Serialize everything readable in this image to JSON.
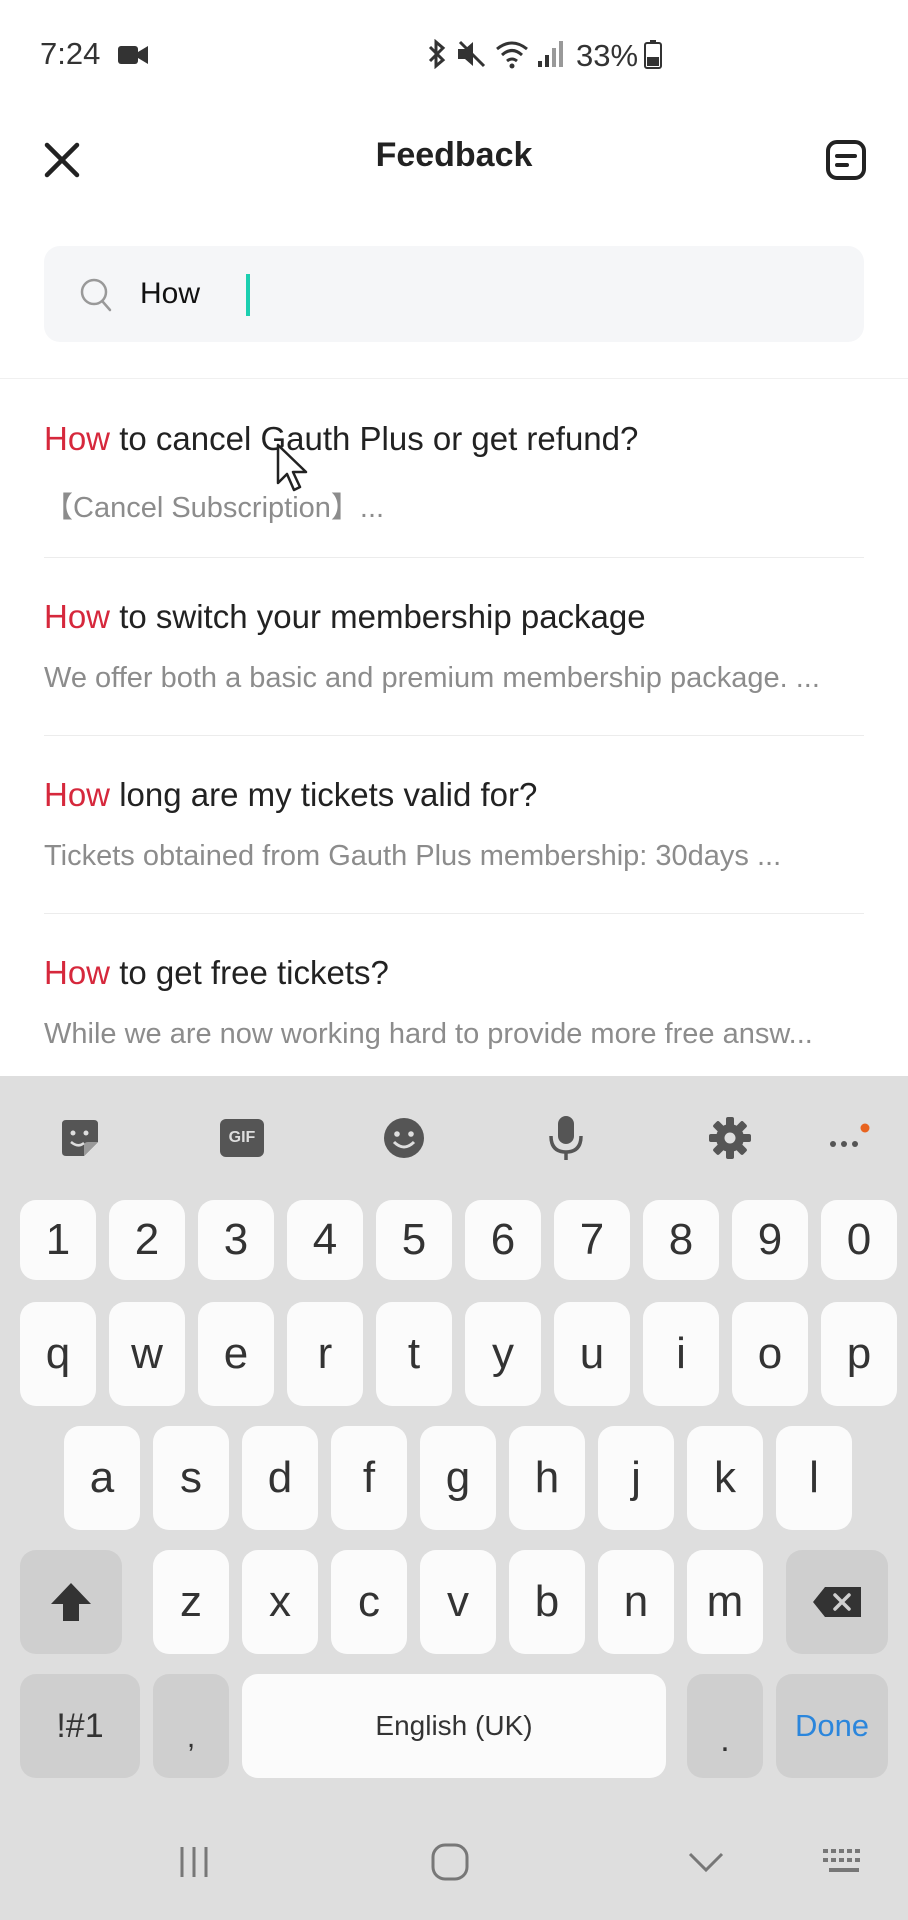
{
  "status_bar": {
    "time": "7:24",
    "battery": "33%"
  },
  "header": {
    "title": "Feedback"
  },
  "search": {
    "value": "How",
    "highlight_color": "#d6283c",
    "caret_color": "#1ccfb0"
  },
  "results": [
    {
      "highlight": "How",
      "rest": " to cancel Gauth Plus or get refund?",
      "snippet": "【Cancel Subscription】..."
    },
    {
      "highlight": "How",
      "rest": " to switch your membership package",
      "snippet": "We offer both a basic and premium membership package. ..."
    },
    {
      "highlight": "How",
      "rest": " long are my tickets valid for?",
      "snippet": "Tickets obtained from Gauth Plus membership: 30days ..."
    },
    {
      "highlight": "How",
      "rest": " to get free tickets?",
      "snippet": "While we are now working hard to provide more free answ..."
    }
  ],
  "keyboard": {
    "toolbar": {
      "gif_label": "GIF"
    },
    "row_numbers": [
      "1",
      "2",
      "3",
      "4",
      "5",
      "6",
      "7",
      "8",
      "9",
      "0"
    ],
    "row_q": [
      "q",
      "w",
      "e",
      "r",
      "t",
      "y",
      "u",
      "i",
      "o",
      "p"
    ],
    "row_a": [
      "a",
      "s",
      "d",
      "f",
      "g",
      "h",
      "j",
      "k",
      "l"
    ],
    "row_z": [
      "z",
      "x",
      "c",
      "v",
      "b",
      "n",
      "m"
    ],
    "symbols_label": "!#1",
    "comma_label": ",",
    "space_label": "English (UK)",
    "period_label": ".",
    "done_label": "Done",
    "accent_color": "#2b86dc"
  }
}
